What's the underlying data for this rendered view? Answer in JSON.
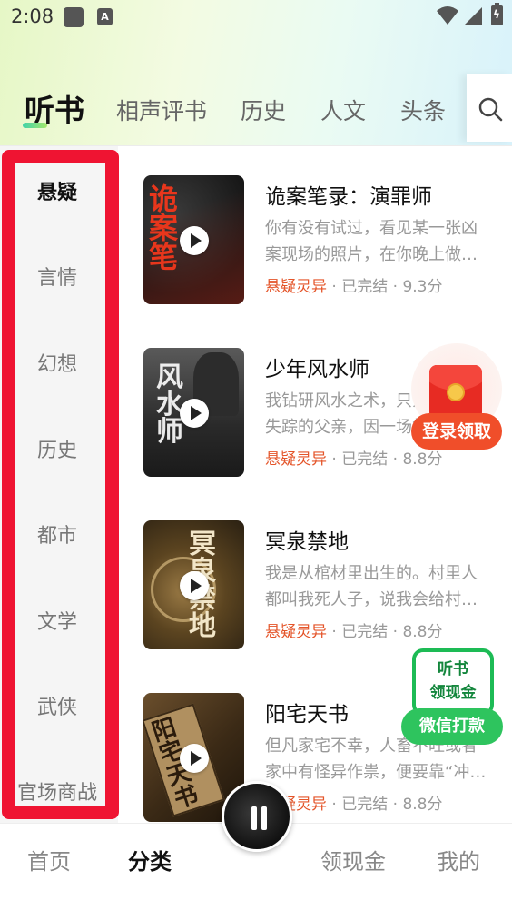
{
  "status_bar": {
    "time": "2:08",
    "notification_icon_letter": "A"
  },
  "top_tabs": [
    {
      "label": "听书",
      "active": true
    },
    {
      "label": "相声评书",
      "active": false
    },
    {
      "label": "历史",
      "active": false
    },
    {
      "label": "人文",
      "active": false
    },
    {
      "label": "头条",
      "active": false
    }
  ],
  "categories": [
    {
      "label": "悬疑",
      "active": true
    },
    {
      "label": "言情",
      "active": false
    },
    {
      "label": "幻想",
      "active": false
    },
    {
      "label": "历史",
      "active": false
    },
    {
      "label": "都市",
      "active": false
    },
    {
      "label": "文学",
      "active": false
    },
    {
      "label": "武侠",
      "active": false
    },
    {
      "label": "官场商战",
      "active": false
    }
  ],
  "books": [
    {
      "title": "诡案笔录：演罪师",
      "desc": "你有没有试过，看见某一张凶案现场的照片，在你晚上做…",
      "genre": "悬疑灵异",
      "status": "已完结",
      "score": "9.3分",
      "cover_text": "诡案笔"
    },
    {
      "title": "少年风水师",
      "desc": "我钻研风水之术，只为了寻找失踪的父亲，因一场相…",
      "genre": "悬疑灵异",
      "status": "已完结",
      "score": "8.8分",
      "cover_text": "风水师"
    },
    {
      "title": "冥泉禁地",
      "desc": "我是从棺材里出生的。村里人都叫我死人子，说我会给村…",
      "genre": "悬疑灵异",
      "status": "已完结",
      "score": "8.8分",
      "cover_text": "冥泉禁地"
    },
    {
      "title": "阳宅天书",
      "desc": "但凡家宅不幸，人畜不旺或者家中有怪异作祟，便要靠“冲…",
      "genre": "悬疑灵异",
      "status": "已完结",
      "score": "8.8分",
      "cover_text": "阳宅天书"
    }
  ],
  "meta_separator": "·",
  "login_reward": {
    "label": "登录领取"
  },
  "wx_cash": {
    "line1": "听书",
    "line2": "领现金",
    "button": "微信打款"
  },
  "bottom_nav": [
    {
      "label": "首页",
      "active": false
    },
    {
      "label": "分类",
      "active": true
    },
    {
      "label": "领现金",
      "active": false
    },
    {
      "label": "我的",
      "active": false
    }
  ],
  "colors": {
    "accent_red": "#ef1432",
    "genre": "#e4552a",
    "wechat_green": "#2ec45e"
  }
}
